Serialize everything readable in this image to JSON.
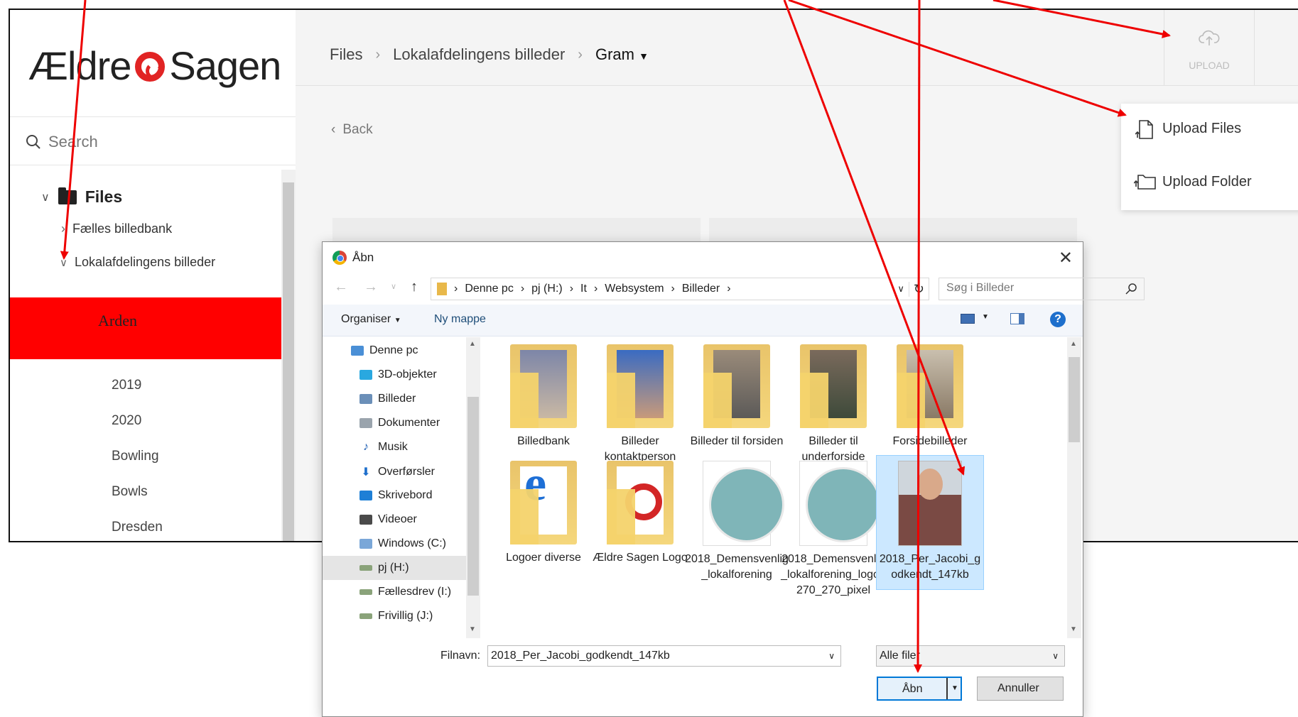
{
  "app": {
    "logo_text_a": "Ældre",
    "logo_text_b": "Sagen",
    "search_placeholder": "Search",
    "tree": {
      "root_label": "Files",
      "items": [
        "Fælles billedbank",
        "Lokalafdelingens billeder"
      ],
      "selected": "Arden",
      "subitems": [
        "2019",
        "2020",
        "Bowling",
        "Bowls",
        "Dresden"
      ]
    },
    "breadcrumb": {
      "items": [
        "Files",
        "Lokalafdelingens billeder"
      ],
      "current": "Gram",
      "sep": "›"
    },
    "back_label": "Back",
    "upload": {
      "label": "UPLOAD",
      "menu": [
        "Upload Files",
        "Upload Folder"
      ]
    },
    "accent_color": "#ff0000"
  },
  "dialog": {
    "title": "Åbn",
    "path": [
      "Denne pc",
      "pj (H:)",
      "It",
      "Websystem",
      "Billeder"
    ],
    "search_placeholder": "Søg i Billeder",
    "toolbar": {
      "organize": "Organiser",
      "new_folder": "Ny mappe"
    },
    "nav": [
      "Denne pc",
      "3D-objekter",
      "Billeder",
      "Dokumenter",
      "Musik",
      "Overførsler",
      "Skrivebord",
      "Videoer",
      "Windows (C:)",
      "pj (H:)",
      "Fællesdrev (I:)",
      "Frivillig (J:)"
    ],
    "files": [
      {
        "name": "Billedbank"
      },
      {
        "name": "Billeder kontaktperson"
      },
      {
        "name": "Billeder til forsiden"
      },
      {
        "name": "Billeder til underforside"
      },
      {
        "name": "Forsidebilleder"
      },
      {
        "name": "Logoer diverse"
      },
      {
        "name": "Ældre Sagen Logo"
      },
      {
        "name": "2018_Demensvenlig_lokalforening"
      },
      {
        "name": "2018_Demensvenlig_lokalforening_logo_270_270_pixel"
      },
      {
        "name": "2018_Per_Jacobi_godkendt_147kb"
      }
    ],
    "filename_label": "Filnavn:",
    "filename_value": "2018_Per_Jacobi_godkendt_147kb",
    "filter_value": "Alle filer",
    "open_label": "Åbn",
    "cancel_label": "Annuller"
  }
}
